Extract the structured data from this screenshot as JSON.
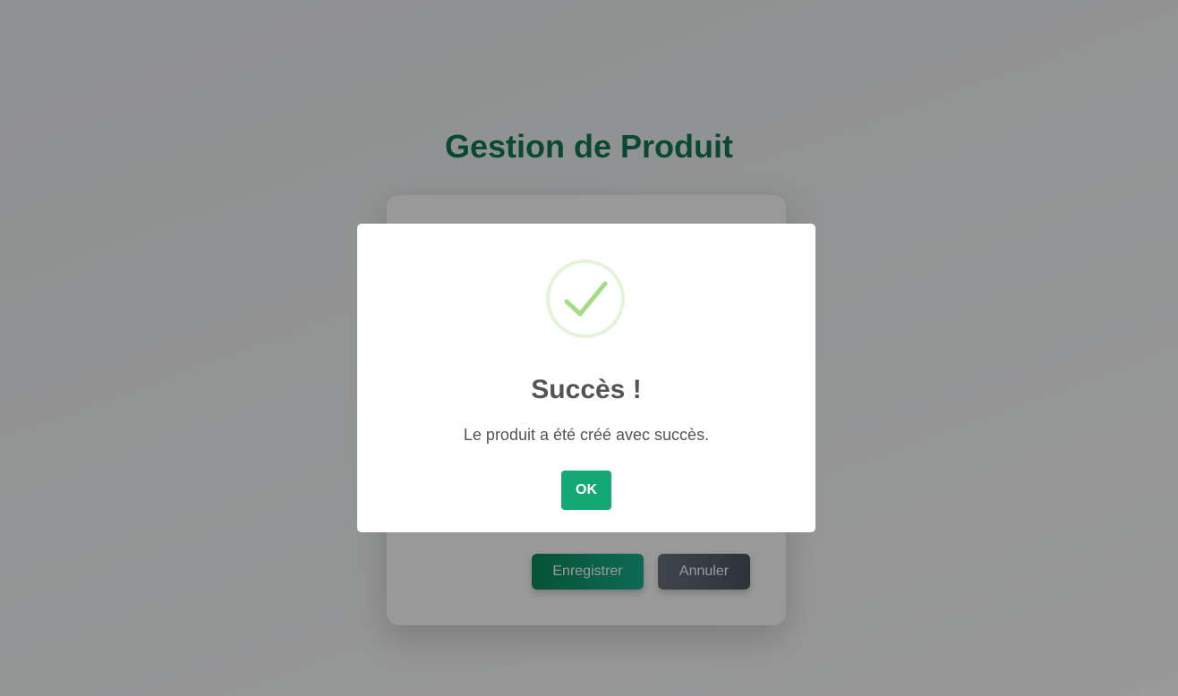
{
  "page": {
    "title": "Gestion de Produit"
  },
  "form": {
    "save_label": "Enregistrer",
    "cancel_label": "Annuler"
  },
  "modal": {
    "title": "Succès !",
    "message": "Le produit a été créé avec succès.",
    "ok_label": "OK",
    "icon": "check-circle-icon"
  },
  "colors": {
    "accent": "#13a874",
    "title": "#0f7a52",
    "success_icon": "#a5dc86"
  }
}
